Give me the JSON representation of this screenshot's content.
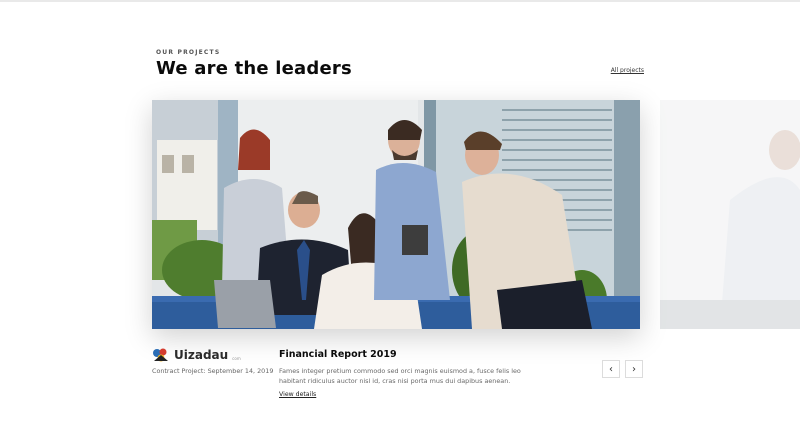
{
  "header": {
    "eyebrow": "OUR PROJECTS",
    "title": "We are the leaders",
    "all_projects_link": "All projects"
  },
  "project": {
    "brand_name": "Uizadau",
    "brand_sub": "com",
    "contract": "Contract Project: September 14, 2019",
    "title": "Financial Report 2019",
    "description": "Fames integer pretium commodo sed orci magnis euismod a, fusce felis leo habitant ridiculus auctor nisl id, cras nisi porta mus dui dapibus aenean.",
    "details_link": "View details"
  },
  "carousel": {
    "prev_icon": "chevron-left-icon",
    "next_icon": "chevron-right-icon",
    "prev_glyph": "‹",
    "next_glyph": "›"
  },
  "colors": {
    "brand_blue": "#2a6db5",
    "brand_red": "#d43c2f",
    "brand_yellow": "#f0b41c"
  }
}
